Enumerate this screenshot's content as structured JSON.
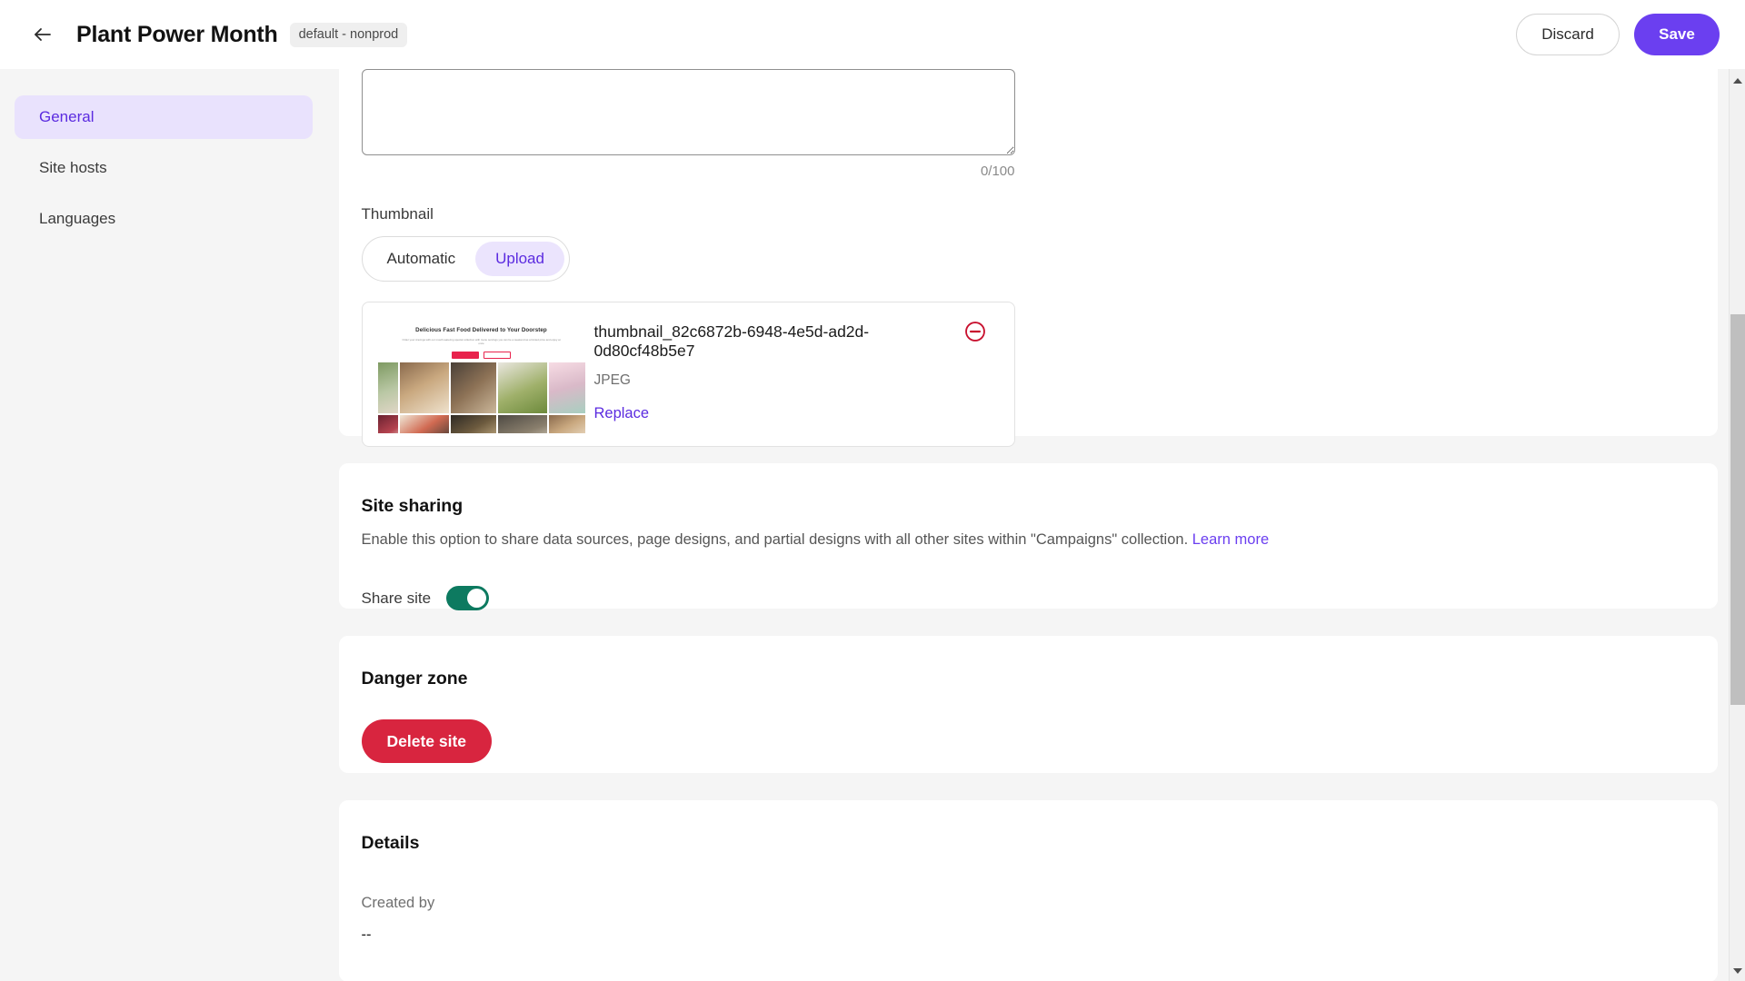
{
  "header": {
    "back_icon": "arrow-left-icon",
    "title": "Plant Power Month",
    "env_badge": "default - nonprod",
    "discard_label": "Discard",
    "save_label": "Save"
  },
  "sidebar": {
    "items": [
      {
        "label": "General",
        "active": true
      },
      {
        "label": "Site hosts",
        "active": false
      },
      {
        "label": "Languages",
        "active": false
      }
    ]
  },
  "description": {
    "value": "",
    "counter": "0/100"
  },
  "thumbnail": {
    "label": "Thumbnail",
    "options": [
      {
        "label": "Automatic",
        "selected": false
      },
      {
        "label": "Upload",
        "selected": true
      }
    ],
    "file": {
      "name": "thumbnail_82c6872b-6948-4e5d-ad2d-0d80cf48b5e7",
      "type": "JPEG",
      "replace_label": "Replace",
      "remove_icon": "circle-minus-icon"
    },
    "preview": {
      "headline": "Delicious Fast Food Delivered to Your Doorstep",
      "subtext": "Order your cravings with our mouth-watering special collection with menu servings you can be a weekend as a limited price and enjoy at once",
      "primary_button": "Order now",
      "secondary_button": "See more"
    }
  },
  "site_sharing": {
    "title": "Site sharing",
    "description": "Enable this option to share data sources, page designs, and partial designs with all other sites within \"Campaigns\" collection.",
    "learn_more": "Learn more",
    "toggle_label": "Share site",
    "toggle_on": true,
    "toggle_color": "#0d7a60"
  },
  "danger_zone": {
    "title": "Danger zone",
    "delete_label": "Delete site",
    "delete_color": "#d8253f"
  },
  "details": {
    "title": "Details",
    "created_by_label": "Created by",
    "created_by_value": "--"
  },
  "colors": {
    "accent": "#6b3ff0",
    "accent_soft": "#e9e2fd",
    "page_bg": "#f5f5f5"
  }
}
